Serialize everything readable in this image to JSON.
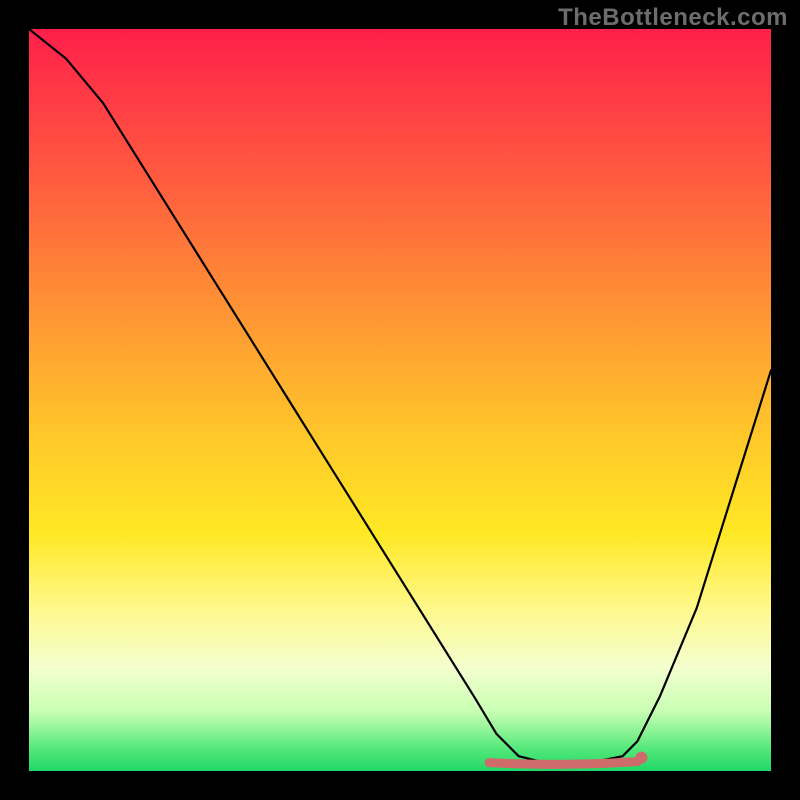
{
  "watermark": "TheBottleneck.com",
  "chart_data": {
    "type": "line",
    "title": "",
    "xlabel": "",
    "ylabel": "",
    "xlim": [
      0,
      100
    ],
    "ylim": [
      0,
      100
    ],
    "legend": false,
    "grid": false,
    "gradient_stops": [
      {
        "pos": 0.0,
        "color": "#ff1f4a"
      },
      {
        "pos": 0.25,
        "color": "#ff6a3c"
      },
      {
        "pos": 0.55,
        "color": "#ffc82a"
      },
      {
        "pos": 0.78,
        "color": "#fff88a"
      },
      {
        "pos": 0.92,
        "color": "#c8ffb3"
      },
      {
        "pos": 1.0,
        "color": "#20d867"
      }
    ],
    "series": [
      {
        "name": "bottleneck-curve",
        "color": "#000000",
        "x": [
          0,
          5,
          10,
          15,
          20,
          25,
          30,
          35,
          40,
          45,
          50,
          55,
          60,
          63,
          66,
          70,
          75,
          80,
          82,
          85,
          90,
          95,
          100
        ],
        "values": [
          100,
          96,
          90,
          82,
          74,
          66,
          58,
          50,
          42,
          34,
          26,
          18,
          10,
          5,
          2,
          1,
          1,
          2,
          4,
          10,
          22,
          38,
          54
        ]
      }
    ],
    "markers": [
      {
        "name": "flat-bottom-highlight",
        "color": "#d46a6a",
        "x_range": [
          62,
          82
        ],
        "y": 1
      }
    ]
  }
}
